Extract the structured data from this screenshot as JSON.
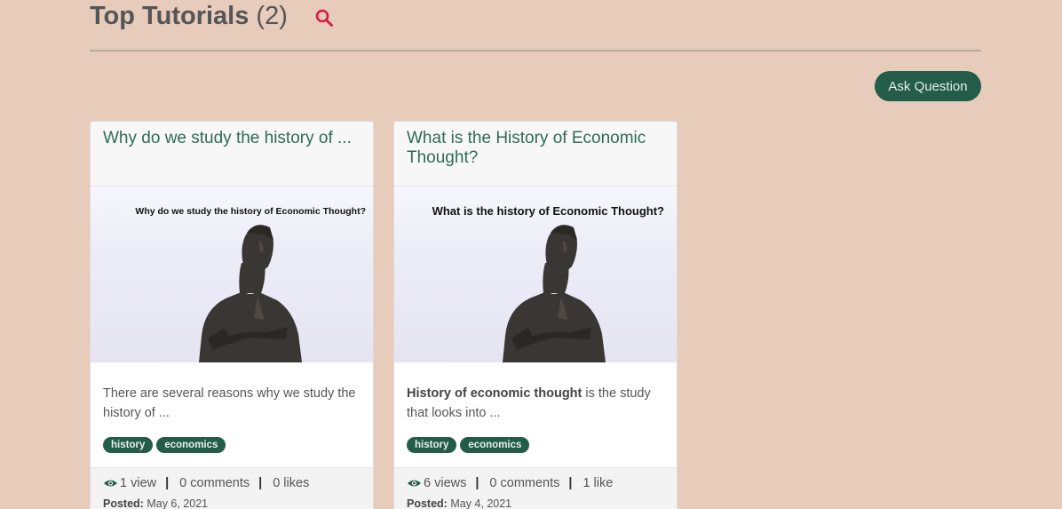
{
  "header": {
    "title": "Top Tutorials",
    "count": "(2)",
    "search_icon": "search-icon"
  },
  "ask_button": "Ask Question",
  "colors": {
    "background": "#e7cbbb",
    "accent": "#245c4a",
    "title_link": "#2e6b57",
    "search_icon": "#d61b45"
  },
  "cards": [
    {
      "title": "Why do we study the history of ...",
      "image_caption": "Why do we study the history of Economic Thought?",
      "excerpt_bold": "",
      "excerpt": "There are several reasons why we study the history of ...",
      "tags": [
        "history",
        "economics"
      ],
      "views": "1 view",
      "comments": "0 comments",
      "likes": "0 likes",
      "posted_label": "Posted:",
      "posted_date": "May 6, 2021"
    },
    {
      "title": "What is the History of Economic Thought?",
      "image_caption": "What is the history of Economic Thought?",
      "excerpt_bold": "History of economic thought",
      "excerpt": " is the study that looks into ...",
      "tags": [
        "history",
        "economics"
      ],
      "views": "6 views",
      "comments": "0 comments",
      "likes": "1 like",
      "posted_label": "Posted:",
      "posted_date": "May 4, 2021"
    }
  ]
}
